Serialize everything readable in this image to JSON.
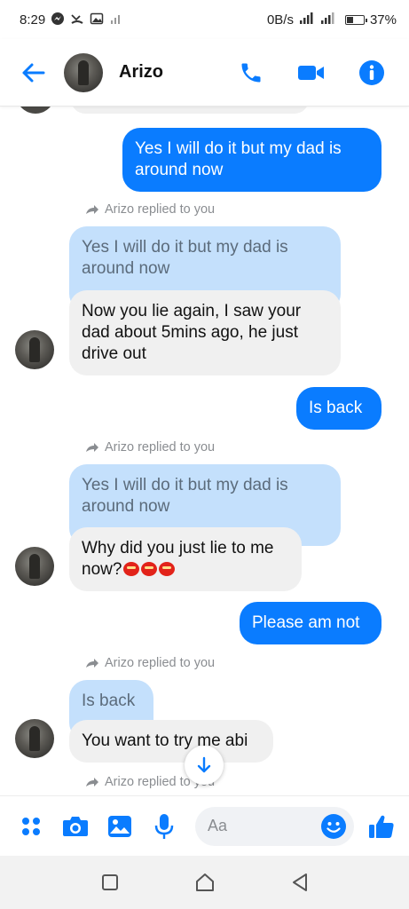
{
  "status_bar": {
    "time": "8:29",
    "data_speed": "0B/s",
    "battery": "37%"
  },
  "header": {
    "contact_name": "Arizo"
  },
  "messages": {
    "m1": "Yes I will do it but my dad is around now",
    "reply_note_1": "Arizo replied to you",
    "quote_1": "Yes I will do it but my dad is around now",
    "m2": "Now you lie again, I saw your dad about 5mins ago, he just drive out",
    "m3": "Is back",
    "reply_note_2": "Arizo replied to you",
    "quote_2": "Yes I will do it but my dad is around now",
    "m4": "Why did you just lie to me now?",
    "m5": "Please am not",
    "reply_note_3": "Arizo replied to you",
    "quote_3": "Is back",
    "m6": "You want to try me abi",
    "reply_note_4": "Arizo replied to you"
  },
  "composer": {
    "placeholder": "Aa"
  },
  "colors": {
    "accent": "#0a7cff",
    "quoted_bubble": "#c4e0fc",
    "incoming_bubble": "#f0f0f0"
  }
}
